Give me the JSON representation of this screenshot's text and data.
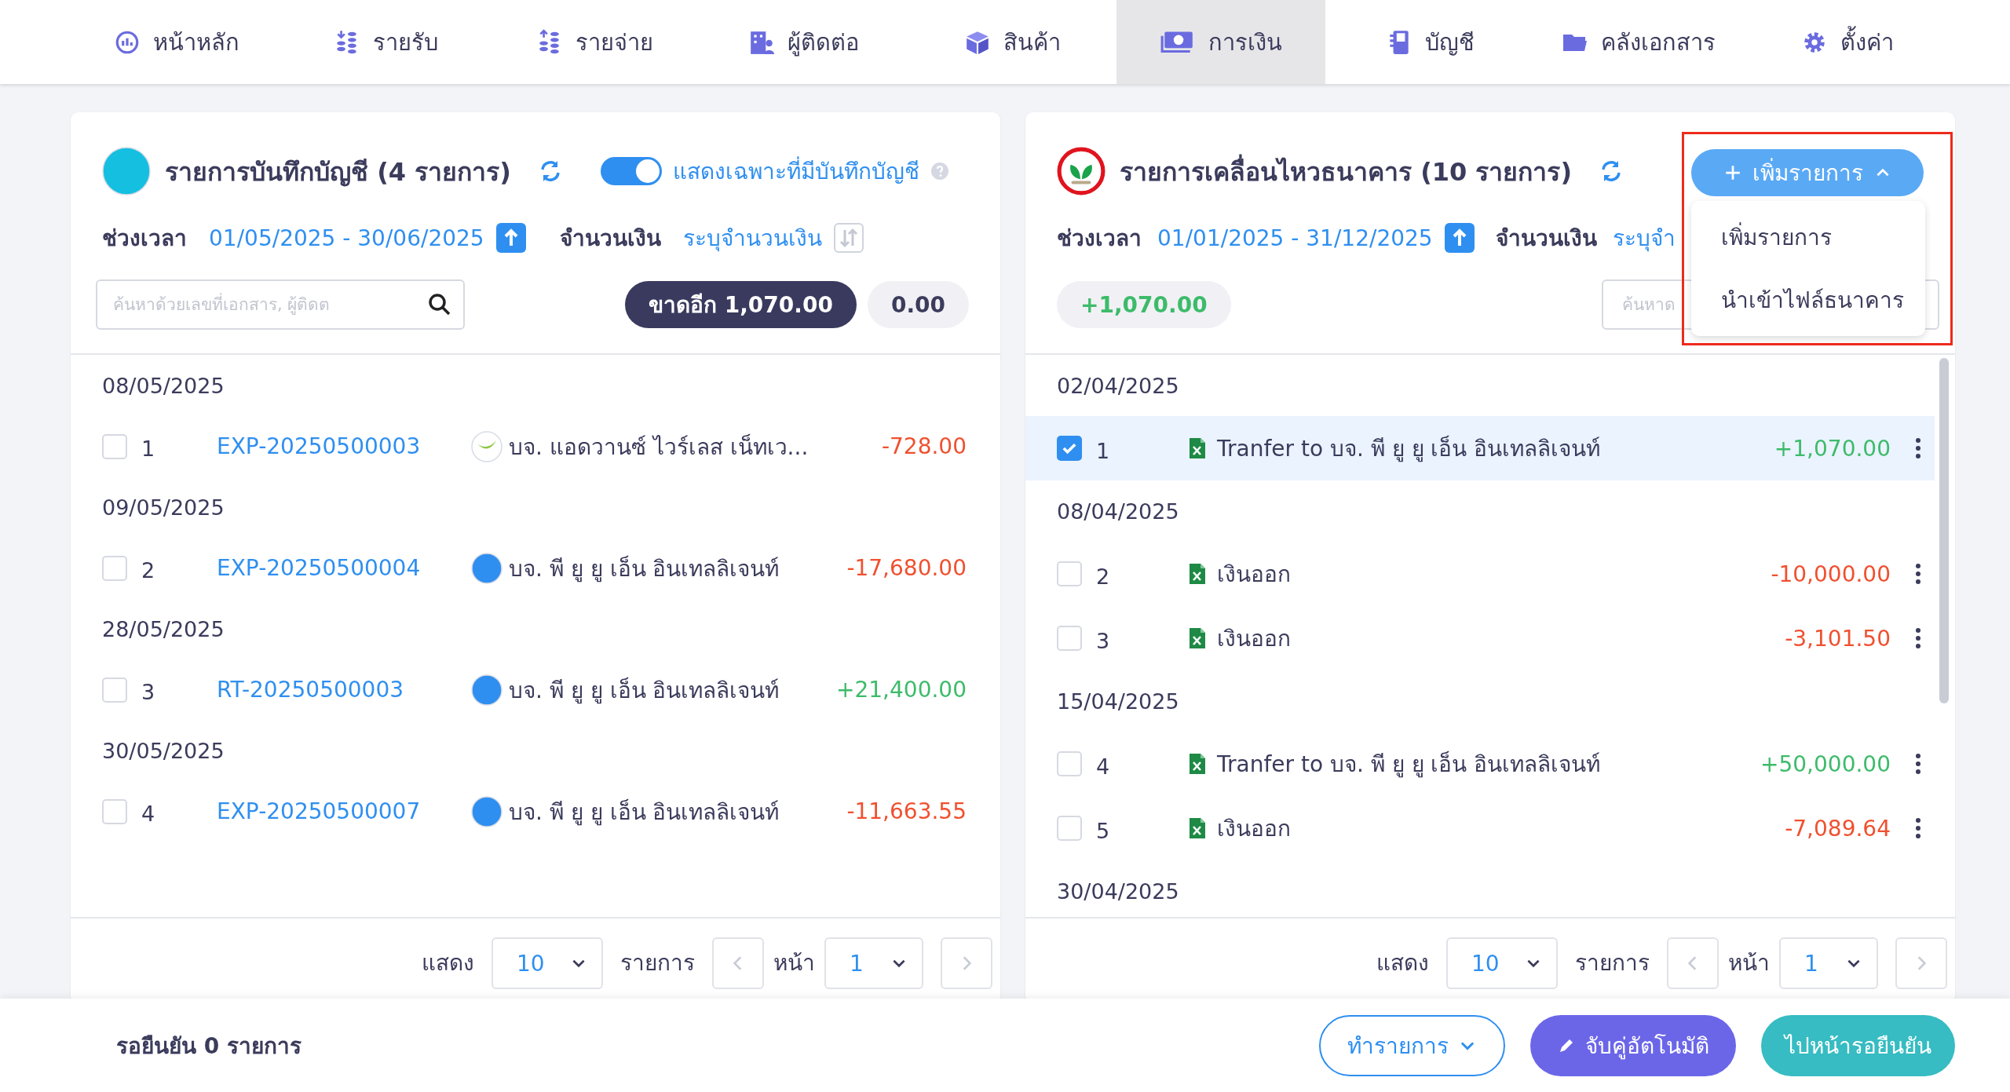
{
  "nav": [
    {
      "label": "หน้าหลัก",
      "kind": "gauge",
      "selected": false
    },
    {
      "label": "รายรับ",
      "kind": "coins-in",
      "selected": false
    },
    {
      "label": "รายจ่าย",
      "kind": "coins-out",
      "selected": false
    },
    {
      "label": "ผู้ติดต่อ",
      "kind": "building",
      "selected": false
    },
    {
      "label": "สินค้า",
      "kind": "box",
      "selected": false
    },
    {
      "label": "การเงิน",
      "kind": "money",
      "selected": true
    },
    {
      "label": "บัญชี",
      "kind": "book",
      "selected": false
    },
    {
      "label": "คลังเอกสาร",
      "kind": "folder",
      "selected": false
    },
    {
      "label": "ตั้งค่า",
      "kind": "gear",
      "selected": false
    }
  ],
  "ledger": {
    "title": "รายการบันทึกบัญชี (4 รายการ)",
    "toggle": {
      "label": "แสดงเฉพาะที่มีบันทึกบัญชี",
      "on": true
    },
    "period_label": "ช่วงเวลา",
    "period": "01/05/2025 - 30/06/2025",
    "amount_label": "จำนวนเงิน",
    "amount_link": "ระบุจำนวนเงิน",
    "search": {
      "placeholder": "ค้นหาด้วยเลขที่เอกสาร, ผู้ติดต"
    },
    "shortfall": "ขาดอีก 1,070.00",
    "total": "0.00",
    "groups": [
      {
        "date": "08/05/2025",
        "rows": [
          {
            "no": "1",
            "doc": "EXP-20250500003",
            "kind": "leaf",
            "contact": "บจ. แอดวานซ์ ไวร์เลส เน็ทเว...",
            "amount": "-728.00",
            "color": "#f0502f",
            "checked": false
          }
        ]
      },
      {
        "date": "09/05/2025",
        "rows": [
          {
            "no": "2",
            "doc": "EXP-20250500004",
            "kind": "peak",
            "contact": "บจ. พี ยู ยู เอ็น อินเทลลิเจนท์",
            "amount": "-17,680.00",
            "color": "#f0502f",
            "checked": false
          }
        ]
      },
      {
        "date": "28/05/2025",
        "rows": [
          {
            "no": "3",
            "doc": "RT-20250500003",
            "kind": "peak",
            "contact": "บจ. พี ยู ยู เอ็น อินเทลลิเจนท์",
            "amount": "+21,400.00",
            "color": "#3dbb6a",
            "checked": false
          }
        ]
      },
      {
        "date": "30/05/2025",
        "rows": [
          {
            "no": "4",
            "doc": "EXP-20250500007",
            "kind": "peak",
            "contact": "บจ. พี ยู ยู เอ็น อินเทลลิเจนท์",
            "amount": "-11,663.55",
            "color": "#f0502f",
            "checked": false
          }
        ]
      }
    ],
    "pagination": {
      "show_label": "แสดง",
      "per_page": "10",
      "items_label": "รายการ",
      "page_label": "หน้า",
      "page": "1"
    }
  },
  "bank": {
    "title": "รายการเคลื่อนไหวธนาคาร (10 รายการ)",
    "add_button": "เพิ่มรายการ",
    "menu": [
      "เพิ่มรายการ",
      "นำเข้าไฟล์ธนาคาร"
    ],
    "period_label": "ช่วงเวลา",
    "period": "01/01/2025 - 31/12/2025",
    "amount_label": "จำนวนเงิน",
    "amount_link": "ระบุจำ",
    "total": "+1,070.00",
    "search": {
      "placeholder": "ค้นหาด"
    },
    "groups": [
      {
        "date": "02/04/2025",
        "rows": [
          {
            "no": "1",
            "text": "Tranfer to บจ. พี ยู ยู เอ็น อินเทลลิเจนท์",
            "amount": "+1,070.00",
            "color": "#3dbb6a",
            "checked": true,
            "selected": true
          }
        ]
      },
      {
        "date": "08/04/2025",
        "rows": [
          {
            "no": "2",
            "text": "เงินออก",
            "amount": "-10,000.00",
            "color": "#f0502f",
            "checked": false,
            "selected": false
          },
          {
            "no": "3",
            "text": "เงินออก",
            "amount": "-3,101.50",
            "color": "#f0502f",
            "checked": false,
            "selected": false
          }
        ]
      },
      {
        "date": "15/04/2025",
        "rows": [
          {
            "no": "4",
            "text": "Tranfer to บจ. พี ยู ยู เอ็น อินเทลลิเจนท์",
            "amount": "+50,000.00",
            "color": "#3dbb6a",
            "checked": false,
            "selected": false
          },
          {
            "no": "5",
            "text": "เงินออก",
            "amount": "-7,089.64",
            "color": "#f0502f",
            "checked": false,
            "selected": false
          }
        ]
      },
      {
        "date": "30/04/2025"
      }
    ],
    "pagination": {
      "show_label": "แสดง",
      "per_page": "10",
      "items_label": "รายการ",
      "page_label": "หน้า",
      "page": "1"
    }
  },
  "footer": {
    "pending": "รอยืนยัน 0 รายการ",
    "buttons": [
      {
        "label": "ทำรายการ",
        "kind": "outline"
      },
      {
        "label": "จับคู่อัตโนมัติ",
        "kind": "auto"
      },
      {
        "label": "ไปหน้ารอยืนยัน",
        "kind": "confirm"
      }
    ]
  }
}
